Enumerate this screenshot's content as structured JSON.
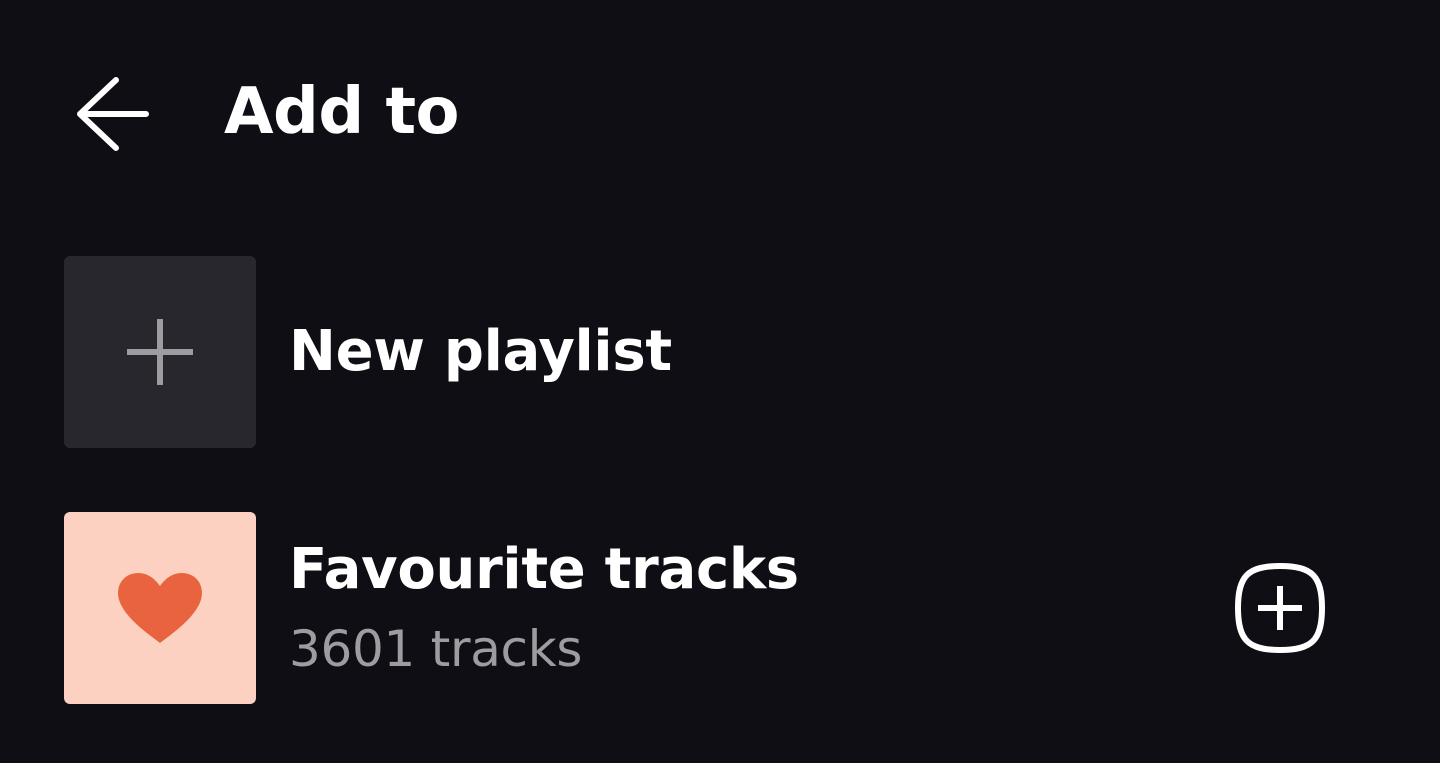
{
  "header": {
    "back_icon": "arrow-left-icon",
    "title": "Add to"
  },
  "new_playlist": {
    "icon": "plus-icon",
    "label": "New playlist"
  },
  "playlists": [
    {
      "name": "Favourite tracks",
      "track_count": "3601 tracks",
      "cover_icon": "heart-icon",
      "add_icon": "add-square-icon"
    }
  ],
  "colors": {
    "background": "#100e15",
    "new_thumb_bg": "#28272e",
    "plus_gray": "#9d9ca1",
    "fav_cover_bg": "#fdd1c1",
    "heart": "#e8633e",
    "subtitle": "#9d9ca1"
  }
}
